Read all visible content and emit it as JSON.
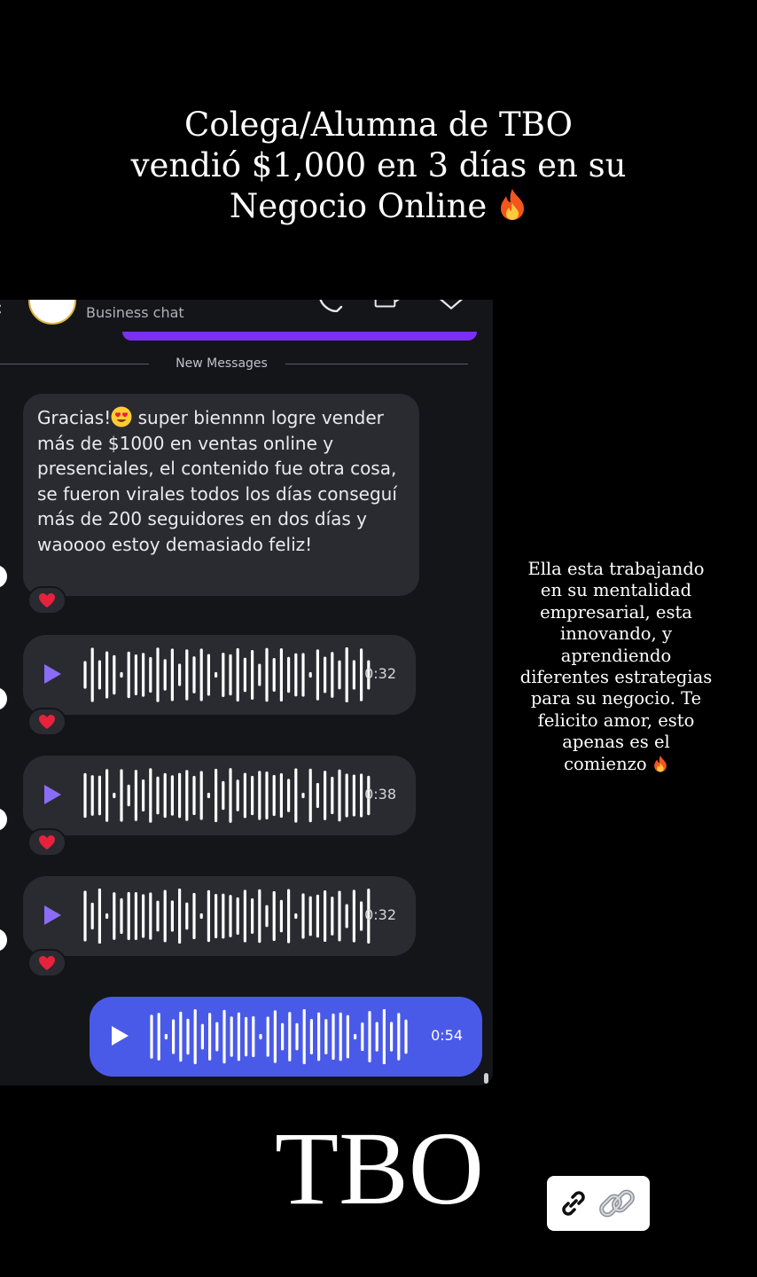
{
  "headline": {
    "line1": "Colega/Alumna de TBO",
    "line2": "vendió $1,000 en 3 días en su",
    "line3": "Negocio Online",
    "emoji": "fire"
  },
  "chat": {
    "header_subtitle": "Business chat",
    "divider_label": "New Messages",
    "message": {
      "before_emoji": "Gracias!",
      "emoji": "heart-eyes",
      "after_emoji": " super biennnn logre vender más de $1000 en ventas online y presenciales, el contenido fue otra cosa, se fueron virales todos los días conseguí más de 200 seguidores en dos días y waoooo estoy demasiado feliz!",
      "reaction": "heart"
    },
    "voice_messages": [
      {
        "duration": "0:32",
        "reaction": "heart"
      },
      {
        "duration": "0:38",
        "reaction": "heart"
      },
      {
        "duration": "0:32",
        "reaction": "heart"
      }
    ],
    "outgoing_voice": {
      "duration": "0:54"
    }
  },
  "side_note": "Ella esta trabajando en su mentalidad empresarial, esta innovando, y aprendiendo diferentes estrategias para su negocio. Te felicito amor, esto apenas es el comienzo",
  "brand": "TBO",
  "link_sticker": {
    "icon": "link-icon",
    "emoji": "chain"
  },
  "colors": {
    "background": "#000000",
    "chat_bg": "#141519",
    "bubble": "#2a2b30",
    "outgoing": "#4a5ae8",
    "accent_purple": "#7b2ff0",
    "play_incoming": "#8b6cf6"
  }
}
